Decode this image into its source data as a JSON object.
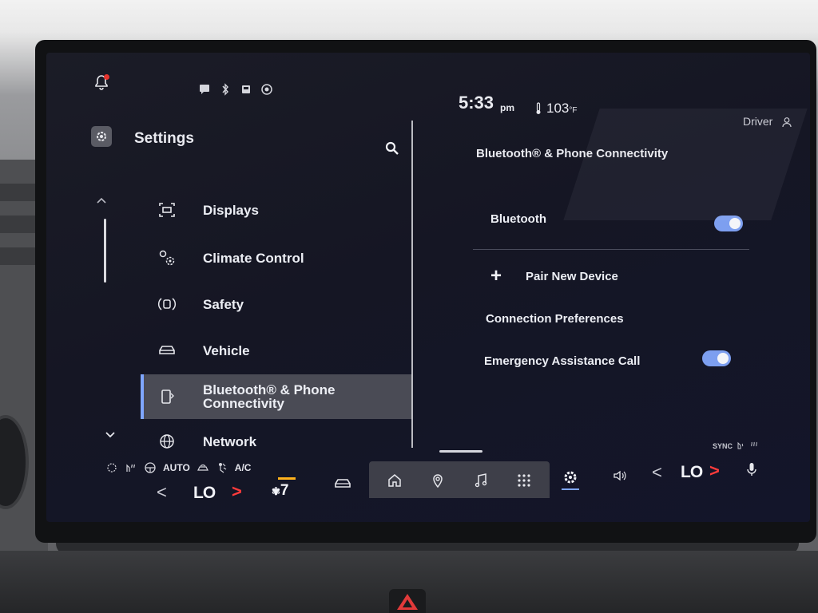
{
  "status": {
    "time": "5:33",
    "ampm": "pm",
    "temperature": "103",
    "temp_unit": "°F",
    "profile": "Driver"
  },
  "sidebar": {
    "title": "Settings",
    "items": [
      {
        "label": "Displays",
        "icon": "display-icon"
      },
      {
        "label": "Climate Control",
        "icon": "climate-icon"
      },
      {
        "label": "Safety",
        "icon": "safety-icon"
      },
      {
        "label": "Vehicle",
        "icon": "vehicle-icon"
      },
      {
        "label": "Bluetooth® & Phone Connectivity",
        "icon": "bluetooth-phone-icon",
        "active": true
      },
      {
        "label": "Network",
        "icon": "globe-icon"
      }
    ]
  },
  "panel": {
    "title": "Bluetooth® & Phone Connectivity",
    "bluetooth_label": "Bluetooth",
    "bluetooth_on": true,
    "pair_label": "Pair New Device",
    "connection_label": "Connection Preferences",
    "emergency_label": "Emergency Assistance Call",
    "emergency_on": true
  },
  "climate": {
    "auto": "AUTO",
    "ac": "A/C",
    "left_temp": "LO",
    "right_temp": "LO",
    "fan_level": "7",
    "sync": "SYNC"
  },
  "colors": {
    "accent": "#7fa6ff",
    "toggle_on": "#7d9ff0",
    "temp_arrow": "#ff3b3b",
    "fan_indicator": "#ffb21c"
  }
}
